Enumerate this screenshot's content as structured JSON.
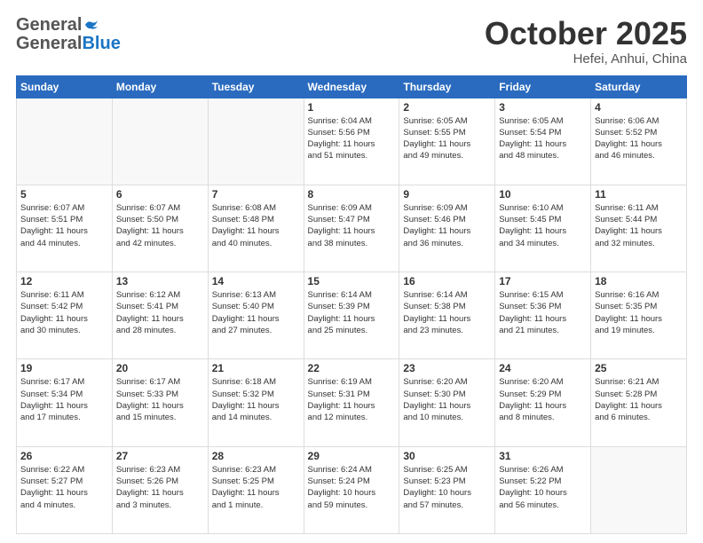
{
  "logo": {
    "general": "General",
    "blue": "Blue"
  },
  "header": {
    "month": "October 2025",
    "location": "Hefei, Anhui, China"
  },
  "weekdays": [
    "Sunday",
    "Monday",
    "Tuesday",
    "Wednesday",
    "Thursday",
    "Friday",
    "Saturday"
  ],
  "weeks": [
    [
      {
        "day": "",
        "info": ""
      },
      {
        "day": "",
        "info": ""
      },
      {
        "day": "",
        "info": ""
      },
      {
        "day": "1",
        "info": "Sunrise: 6:04 AM\nSunset: 5:56 PM\nDaylight: 11 hours\nand 51 minutes."
      },
      {
        "day": "2",
        "info": "Sunrise: 6:05 AM\nSunset: 5:55 PM\nDaylight: 11 hours\nand 49 minutes."
      },
      {
        "day": "3",
        "info": "Sunrise: 6:05 AM\nSunset: 5:54 PM\nDaylight: 11 hours\nand 48 minutes."
      },
      {
        "day": "4",
        "info": "Sunrise: 6:06 AM\nSunset: 5:52 PM\nDaylight: 11 hours\nand 46 minutes."
      }
    ],
    [
      {
        "day": "5",
        "info": "Sunrise: 6:07 AM\nSunset: 5:51 PM\nDaylight: 11 hours\nand 44 minutes."
      },
      {
        "day": "6",
        "info": "Sunrise: 6:07 AM\nSunset: 5:50 PM\nDaylight: 11 hours\nand 42 minutes."
      },
      {
        "day": "7",
        "info": "Sunrise: 6:08 AM\nSunset: 5:48 PM\nDaylight: 11 hours\nand 40 minutes."
      },
      {
        "day": "8",
        "info": "Sunrise: 6:09 AM\nSunset: 5:47 PM\nDaylight: 11 hours\nand 38 minutes."
      },
      {
        "day": "9",
        "info": "Sunrise: 6:09 AM\nSunset: 5:46 PM\nDaylight: 11 hours\nand 36 minutes."
      },
      {
        "day": "10",
        "info": "Sunrise: 6:10 AM\nSunset: 5:45 PM\nDaylight: 11 hours\nand 34 minutes."
      },
      {
        "day": "11",
        "info": "Sunrise: 6:11 AM\nSunset: 5:44 PM\nDaylight: 11 hours\nand 32 minutes."
      }
    ],
    [
      {
        "day": "12",
        "info": "Sunrise: 6:11 AM\nSunset: 5:42 PM\nDaylight: 11 hours\nand 30 minutes."
      },
      {
        "day": "13",
        "info": "Sunrise: 6:12 AM\nSunset: 5:41 PM\nDaylight: 11 hours\nand 28 minutes."
      },
      {
        "day": "14",
        "info": "Sunrise: 6:13 AM\nSunset: 5:40 PM\nDaylight: 11 hours\nand 27 minutes."
      },
      {
        "day": "15",
        "info": "Sunrise: 6:14 AM\nSunset: 5:39 PM\nDaylight: 11 hours\nand 25 minutes."
      },
      {
        "day": "16",
        "info": "Sunrise: 6:14 AM\nSunset: 5:38 PM\nDaylight: 11 hours\nand 23 minutes."
      },
      {
        "day": "17",
        "info": "Sunrise: 6:15 AM\nSunset: 5:36 PM\nDaylight: 11 hours\nand 21 minutes."
      },
      {
        "day": "18",
        "info": "Sunrise: 6:16 AM\nSunset: 5:35 PM\nDaylight: 11 hours\nand 19 minutes."
      }
    ],
    [
      {
        "day": "19",
        "info": "Sunrise: 6:17 AM\nSunset: 5:34 PM\nDaylight: 11 hours\nand 17 minutes."
      },
      {
        "day": "20",
        "info": "Sunrise: 6:17 AM\nSunset: 5:33 PM\nDaylight: 11 hours\nand 15 minutes."
      },
      {
        "day": "21",
        "info": "Sunrise: 6:18 AM\nSunset: 5:32 PM\nDaylight: 11 hours\nand 14 minutes."
      },
      {
        "day": "22",
        "info": "Sunrise: 6:19 AM\nSunset: 5:31 PM\nDaylight: 11 hours\nand 12 minutes."
      },
      {
        "day": "23",
        "info": "Sunrise: 6:20 AM\nSunset: 5:30 PM\nDaylight: 11 hours\nand 10 minutes."
      },
      {
        "day": "24",
        "info": "Sunrise: 6:20 AM\nSunset: 5:29 PM\nDaylight: 11 hours\nand 8 minutes."
      },
      {
        "day": "25",
        "info": "Sunrise: 6:21 AM\nSunset: 5:28 PM\nDaylight: 11 hours\nand 6 minutes."
      }
    ],
    [
      {
        "day": "26",
        "info": "Sunrise: 6:22 AM\nSunset: 5:27 PM\nDaylight: 11 hours\nand 4 minutes."
      },
      {
        "day": "27",
        "info": "Sunrise: 6:23 AM\nSunset: 5:26 PM\nDaylight: 11 hours\nand 3 minutes."
      },
      {
        "day": "28",
        "info": "Sunrise: 6:23 AM\nSunset: 5:25 PM\nDaylight: 11 hours\nand 1 minute."
      },
      {
        "day": "29",
        "info": "Sunrise: 6:24 AM\nSunset: 5:24 PM\nDaylight: 10 hours\nand 59 minutes."
      },
      {
        "day": "30",
        "info": "Sunrise: 6:25 AM\nSunset: 5:23 PM\nDaylight: 10 hours\nand 57 minutes."
      },
      {
        "day": "31",
        "info": "Sunrise: 6:26 AM\nSunset: 5:22 PM\nDaylight: 10 hours\nand 56 minutes."
      },
      {
        "day": "",
        "info": ""
      }
    ]
  ]
}
